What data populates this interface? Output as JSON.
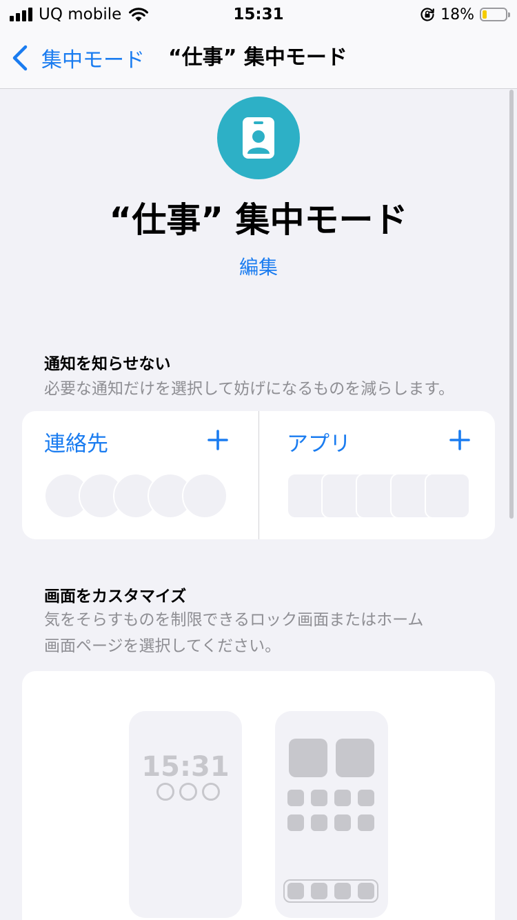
{
  "status_bar": {
    "carrier": "UQ mobile",
    "time": "15:31",
    "battery_percent": "18%",
    "battery_level": 0.18
  },
  "nav": {
    "back_label": "集中モード",
    "title": "“仕事” 集中モード"
  },
  "header": {
    "title": "“仕事” 集中モード",
    "edit_label": "編集",
    "icon": "id-badge-icon",
    "icon_color": "#2db0c6"
  },
  "notifications": {
    "title": "通知を知らせない",
    "description": "必要な通知だけを選択して妨げになるものを減らします。",
    "contacts_label": "連絡先",
    "apps_label": "アプリ"
  },
  "customize": {
    "title": "画面をカスタマイズ",
    "description_line1": "気をそらすものを制限できるロック画面またはホーム",
    "description_line2": "画面ページを選択してください。",
    "lock_screen_time": "15:31"
  },
  "colors": {
    "accent": "#1a7cf0",
    "background": "#f2f2f7",
    "secondary_text": "#8e8e93"
  }
}
